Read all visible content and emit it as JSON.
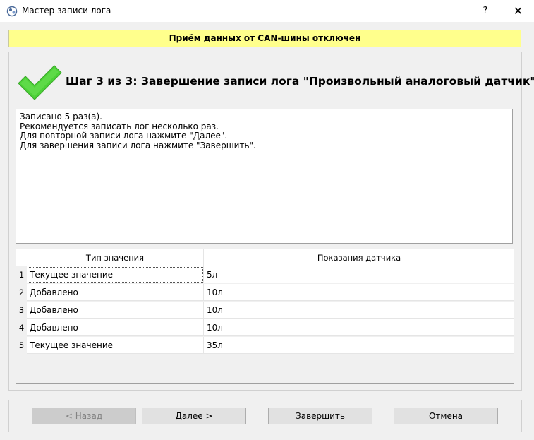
{
  "window": {
    "title": "Мастер записи лога",
    "help_label": "?",
    "close_label": "✕"
  },
  "banner": {
    "text": "Приём данных от CAN-шины отключен",
    "color": "#ffff8c"
  },
  "step": {
    "title": "Шаг 3 из 3: Завершение записи лога \"Произвольный аналоговый датчик\"",
    "icon": "checkmark-icon",
    "icon_color": "#4cd137"
  },
  "message": {
    "lines": [
      "Записано 5 раз(а).",
      "",
      "Рекомендуется записать лог несколько раз.",
      "Для повторной записи лога нажмите \"Далее\".",
      "Для завершения записи лога нажмите \"Завершить\"."
    ]
  },
  "table": {
    "columns": [
      "Тип значения",
      "Показания датчика"
    ],
    "rows": [
      {
        "num": "1",
        "type": "Текущее значение",
        "value": "5л"
      },
      {
        "num": "2",
        "type": "Добавлено",
        "value": "10л"
      },
      {
        "num": "3",
        "type": "Добавлено",
        "value": "10л"
      },
      {
        "num": "4",
        "type": "Добавлено",
        "value": "10л"
      },
      {
        "num": "5",
        "type": "Текущее значение",
        "value": "35л"
      }
    ]
  },
  "buttons": {
    "back": "< Назад",
    "next": "Далее >",
    "finish": "Завершить",
    "cancel": "Отмена"
  }
}
